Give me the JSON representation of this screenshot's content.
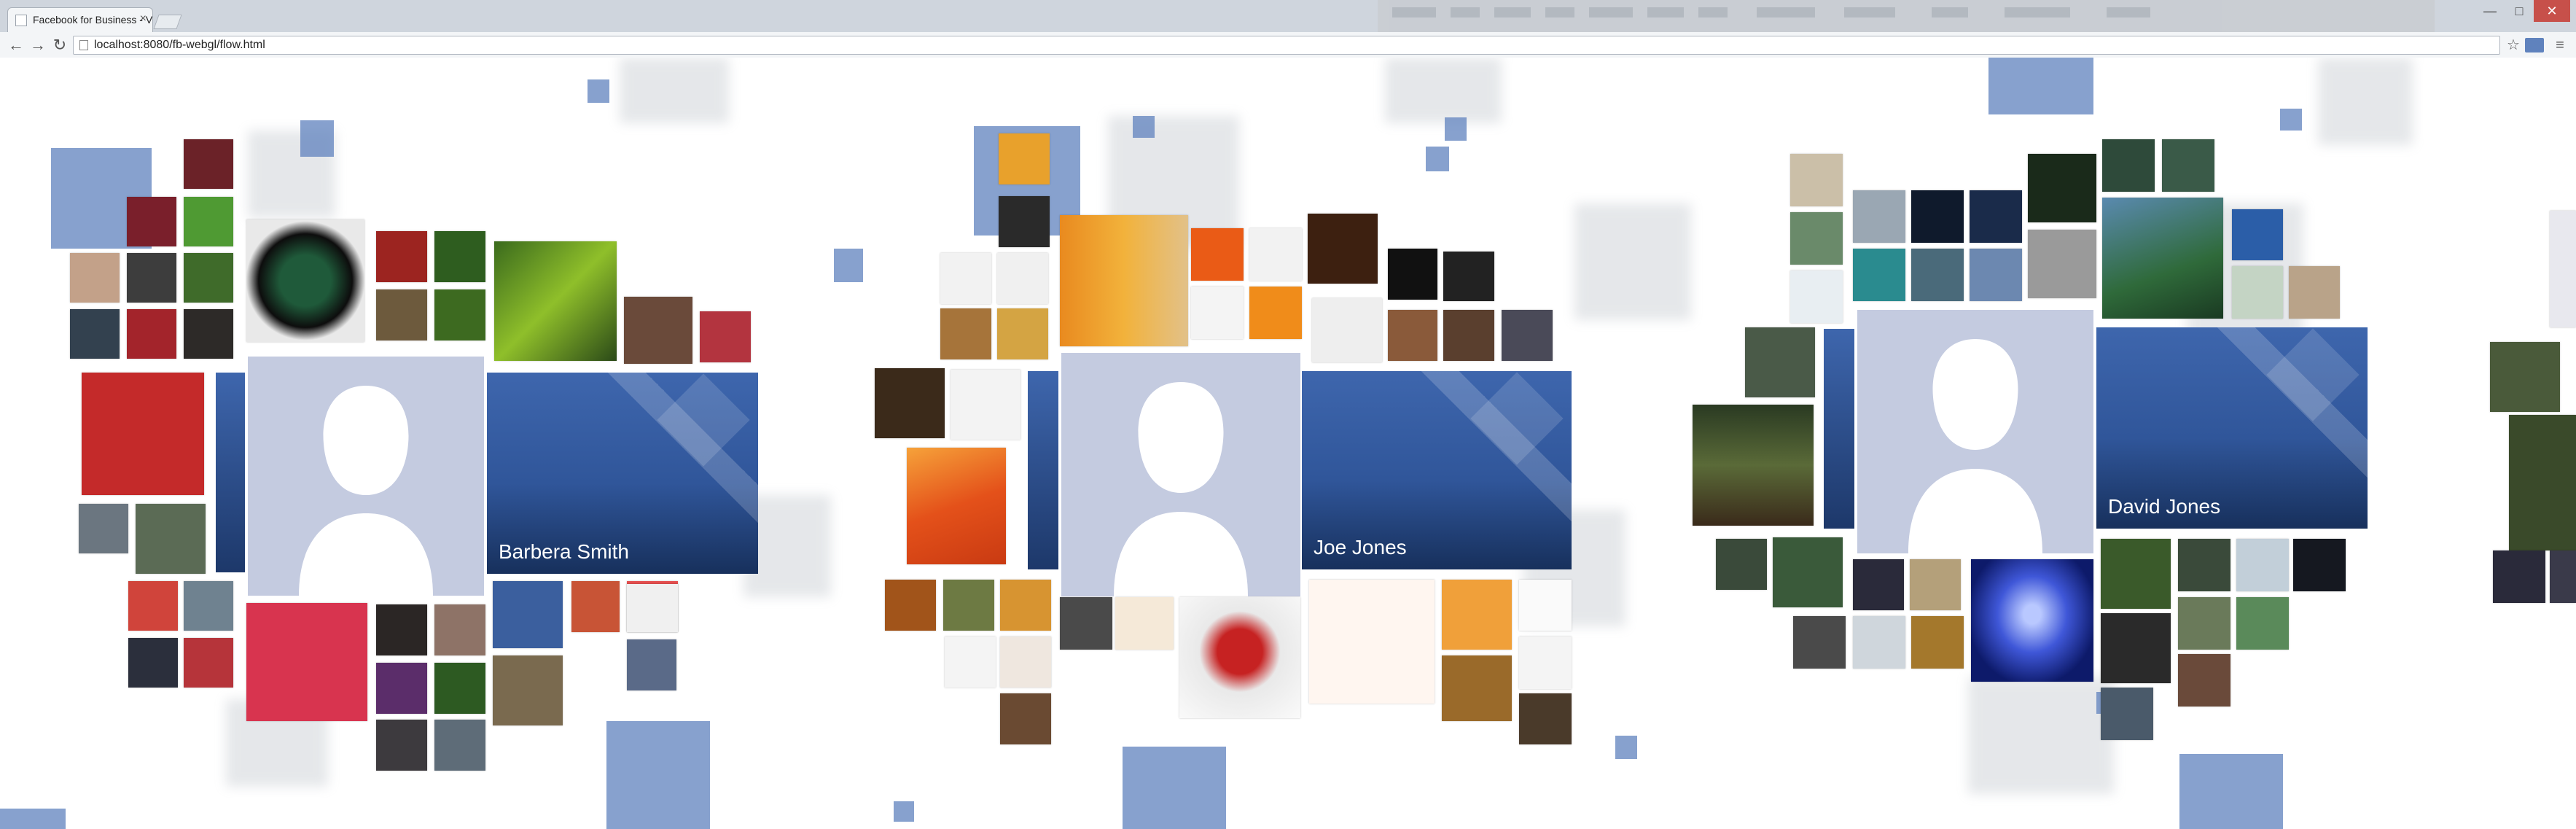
{
  "browser": {
    "tab_title": "Facebook for Business - V",
    "tab_close": "×",
    "url": "localhost:8080/fb-webgl/flow.html",
    "nav": {
      "back": "←",
      "forward": "→",
      "reload": "↻"
    },
    "window_controls": {
      "minimize": "—",
      "maximize": "□",
      "close": "✕"
    },
    "toolbar_icons": {
      "star": "☆",
      "menu": "≡"
    }
  },
  "profiles": [
    {
      "name": "Barbera Smith"
    },
    {
      "name": "Joe Jones"
    },
    {
      "name": "David Jones"
    }
  ],
  "colors": {
    "accent": "#3b5998",
    "cover_top": "#3e66ad",
    "avatar": "#c4cbe0",
    "square": "#5f82bd"
  }
}
